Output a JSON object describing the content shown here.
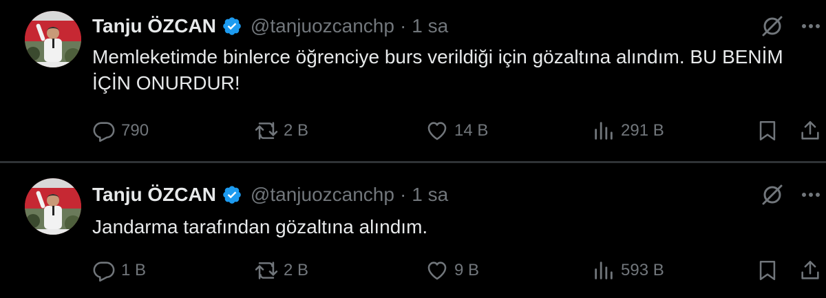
{
  "colors": {
    "background": "#000000",
    "text": "#e7e9ea",
    "secondary": "#71767b",
    "verified": "#1d9bf0",
    "divider": "#2f3336"
  },
  "tweets": [
    {
      "author_name": "Tanju ÖZCAN",
      "handle": "@tanjuozcanchp",
      "separator": "·",
      "time": "1 sa",
      "text": "Memleketimde binlerce öğrenciye burs verildiği için gözaltına alındım. BU BENİM İÇİN ONURDUR!",
      "replies": "790",
      "retweets": "2 B",
      "likes": "14 B",
      "views": "291 B",
      "icons": [
        "avatar",
        "verified-badge-icon",
        "grok-icon",
        "more-icon",
        "reply-icon",
        "retweet-icon",
        "like-icon",
        "views-icon",
        "bookmark-icon",
        "share-icon"
      ]
    },
    {
      "author_name": "Tanju ÖZCAN",
      "handle": "@tanjuozcanchp",
      "separator": "·",
      "time": "1 sa",
      "text": "Jandarma tarafından gözaltına alındım.",
      "replies": "1 B",
      "retweets": "2 B",
      "likes": "9 B",
      "views": "593 B",
      "icons": [
        "avatar",
        "verified-badge-icon",
        "grok-icon",
        "more-icon",
        "reply-icon",
        "retweet-icon",
        "like-icon",
        "views-icon",
        "bookmark-icon",
        "share-icon"
      ]
    }
  ]
}
